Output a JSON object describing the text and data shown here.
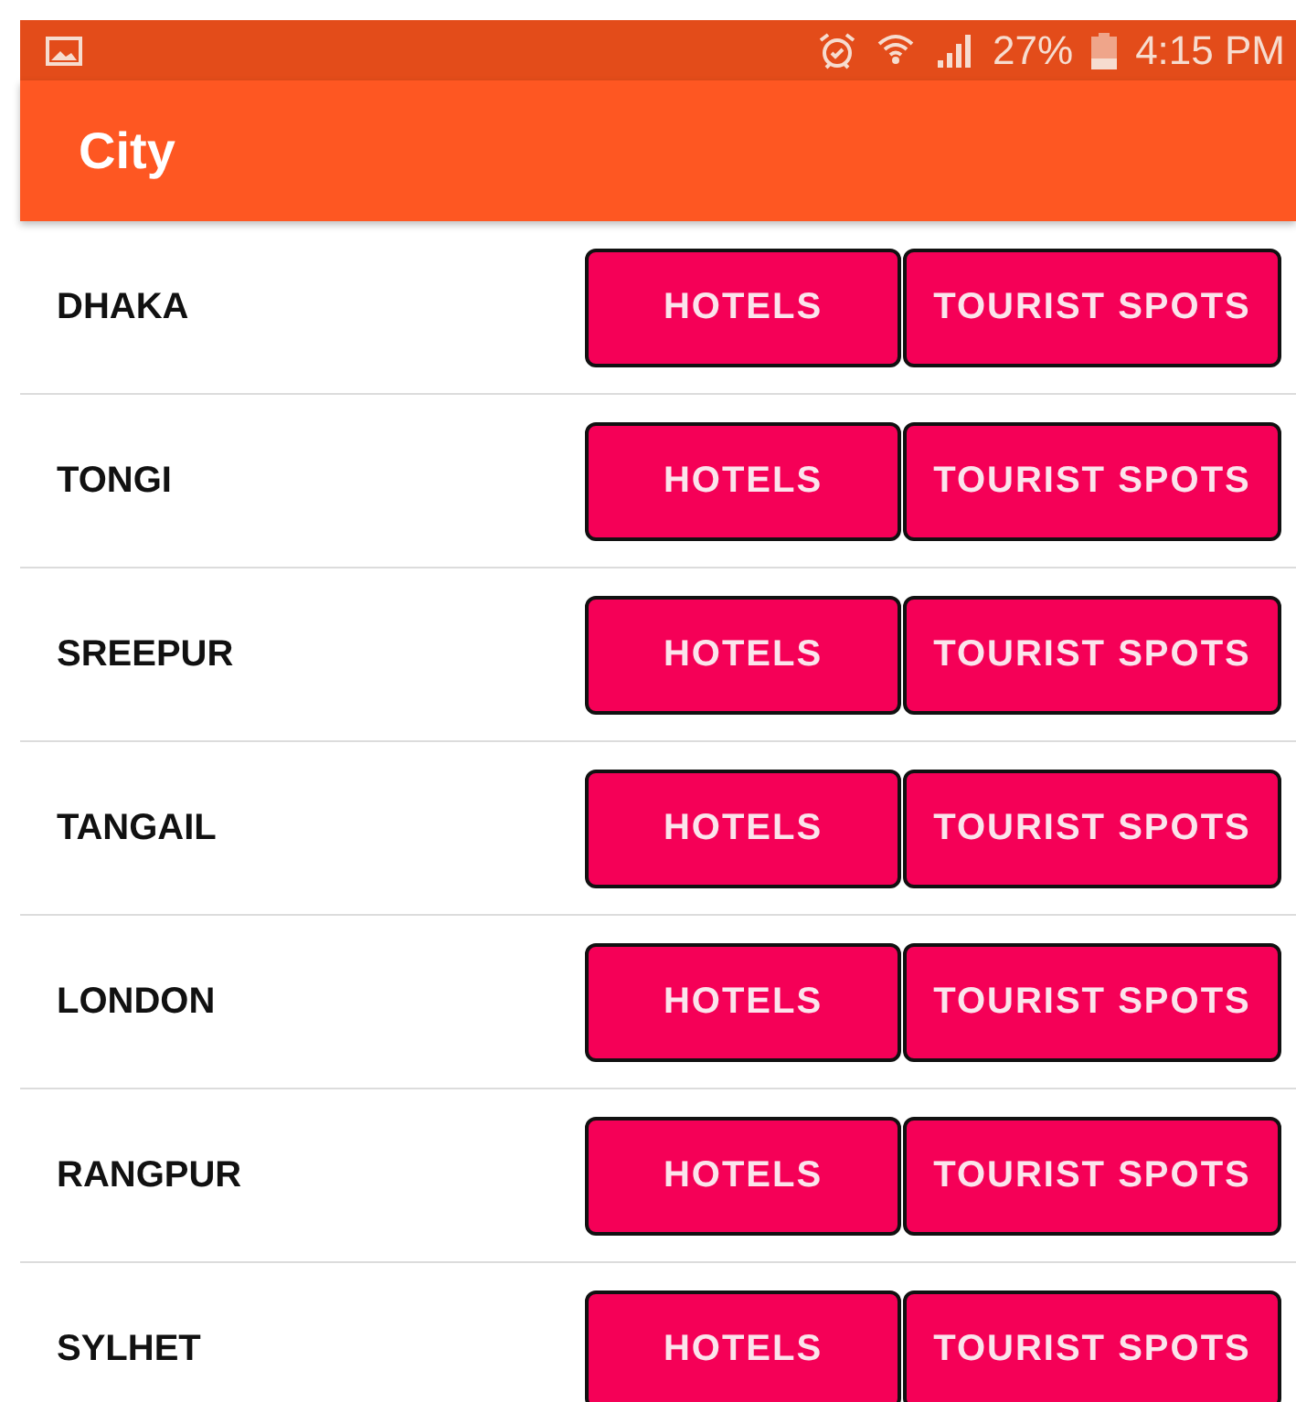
{
  "status_bar": {
    "battery": "27%",
    "time": "4:15 PM"
  },
  "app_bar": {
    "title": "City"
  },
  "cities": [
    {
      "name": "DHAKA",
      "buttons": [
        "HOTELS",
        "TOURIST SPOTS"
      ]
    },
    {
      "name": "TONGI",
      "buttons": [
        "HOTELS",
        "TOURIST SPOTS"
      ]
    },
    {
      "name": "SREEPUR",
      "buttons": [
        "HOTELS",
        "TOURIST SPOTS"
      ]
    },
    {
      "name": "TANGAIL",
      "buttons": [
        "HOTELS",
        "TOURIST SPOTS"
      ]
    },
    {
      "name": "LONDON",
      "buttons": [
        "HOTELS",
        "TOURIST SPOTS"
      ]
    },
    {
      "name": "RANGPUR",
      "buttons": [
        "HOTELS",
        "TOURIST SPOTS"
      ]
    },
    {
      "name": "SYLHET",
      "buttons": [
        "HOTELS",
        "TOURIST SPOTS"
      ]
    }
  ]
}
